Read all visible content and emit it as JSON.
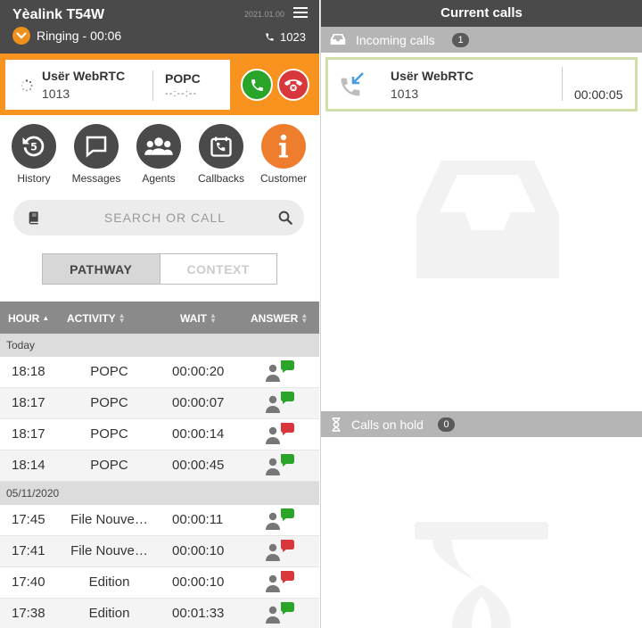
{
  "header": {
    "device": "Yèalink T54W",
    "date": "2021.01.00",
    "status": "Ringing",
    "separator": "-",
    "ring_timer": "00:06",
    "extension": "1023"
  },
  "active_call": {
    "caller_name": "Usër WebRTC",
    "caller_number": "1013",
    "queue": "POPC",
    "queue_timer": "--:--:--"
  },
  "shortcuts": [
    {
      "label": "History",
      "icon": "history-icon"
    },
    {
      "label": "Messages",
      "icon": "messages-icon"
    },
    {
      "label": "Agents",
      "icon": "agents-icon"
    },
    {
      "label": "Callbacks",
      "icon": "callbacks-icon"
    },
    {
      "label": "Customer",
      "icon": "info-icon"
    }
  ],
  "search": {
    "placeholder": "SEARCH OR CALL"
  },
  "view_toggle": {
    "active": "PATHWAY",
    "inactive": "CONTEXT"
  },
  "history": {
    "columns": [
      "HOUR",
      "ACTIVITY",
      "WAIT",
      "ANSWER"
    ],
    "groups": [
      {
        "label": "Today",
        "rows": [
          {
            "hour": "18:18",
            "activity": "POPC",
            "wait": "00:00:20",
            "answered": true
          },
          {
            "hour": "18:17",
            "activity": "POPC",
            "wait": "00:00:07",
            "answered": true
          },
          {
            "hour": "18:17",
            "activity": "POPC",
            "wait": "00:00:14",
            "answered": false
          },
          {
            "hour": "18:14",
            "activity": "POPC",
            "wait": "00:00:45",
            "answered": true
          }
        ]
      },
      {
        "label": "05/11/2020",
        "rows": [
          {
            "hour": "17:45",
            "activity": "File Nouve…",
            "wait": "00:00:11",
            "answered": true
          },
          {
            "hour": "17:41",
            "activity": "File Nouve…",
            "wait": "00:00:10",
            "answered": false
          },
          {
            "hour": "17:40",
            "activity": "Edition",
            "wait": "00:00:10",
            "answered": false
          },
          {
            "hour": "17:38",
            "activity": "Edition",
            "wait": "00:01:33",
            "answered": true
          }
        ]
      }
    ]
  },
  "current_calls": {
    "title": "Current calls",
    "incoming_label": "Incoming calls",
    "incoming_count": "1",
    "incoming": {
      "name": "Usër WebRTC",
      "number": "1013",
      "duration": "00:00:05"
    },
    "hold_label": "Calls on hold",
    "hold_count": "0"
  },
  "colors": {
    "accent": "#f7931e",
    "accept": "#2aa52a",
    "reject": "#d8373b",
    "answered": "#2aa52a",
    "missed": "#d8373b"
  }
}
